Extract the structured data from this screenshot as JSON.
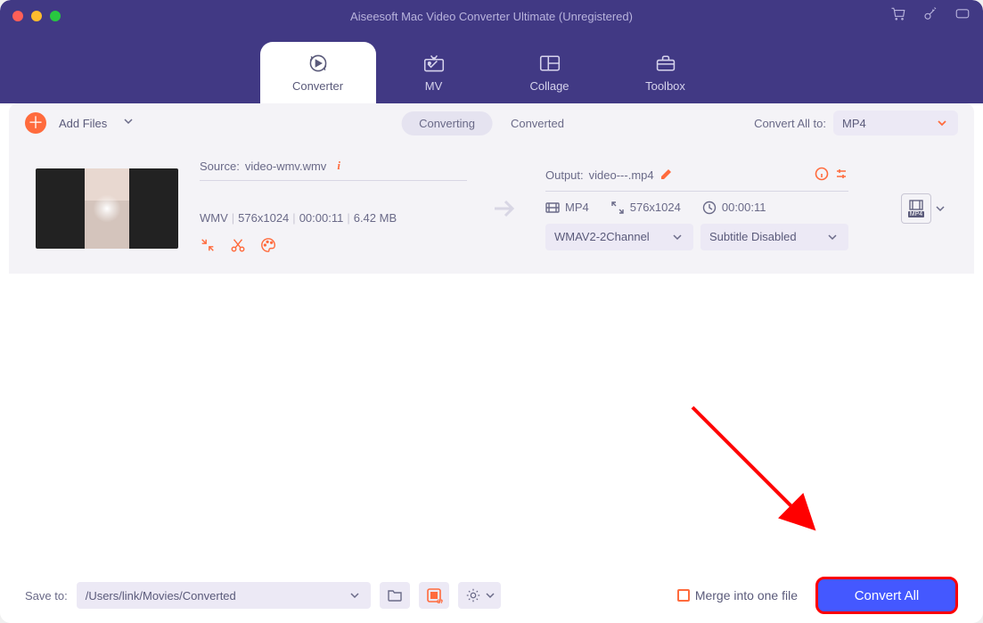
{
  "window": {
    "title": "Aiseesoft Mac Video Converter Ultimate (Unregistered)"
  },
  "tabs": [
    {
      "label": "Converter"
    },
    {
      "label": "MV"
    },
    {
      "label": "Collage"
    },
    {
      "label": "Toolbox"
    }
  ],
  "toolbar": {
    "add_files": "Add Files",
    "segments": {
      "converting": "Converting",
      "converted": "Converted"
    },
    "convert_all_to": "Convert All to:",
    "format": "MP4"
  },
  "file": {
    "source_label": "Source:",
    "source_name": "video-wmv.wmv",
    "meta": {
      "codec": "WMV",
      "dims": "576x1024",
      "dur": "00:00:11",
      "size": "6.42 MB"
    },
    "output_label": "Output:",
    "output_name": "video---.mp4",
    "out_meta": {
      "fmt": "MP4",
      "dims": "576x1024",
      "dur": "00:00:11"
    },
    "audio_dd": "WMAV2-2Channel",
    "sub_dd": "Subtitle Disabled",
    "tile_label": "MP4"
  },
  "bottom": {
    "save_to_label": "Save to:",
    "path": "/Users/link/Movies/Converted",
    "merge": "Merge into one file",
    "convert_all": "Convert All"
  }
}
